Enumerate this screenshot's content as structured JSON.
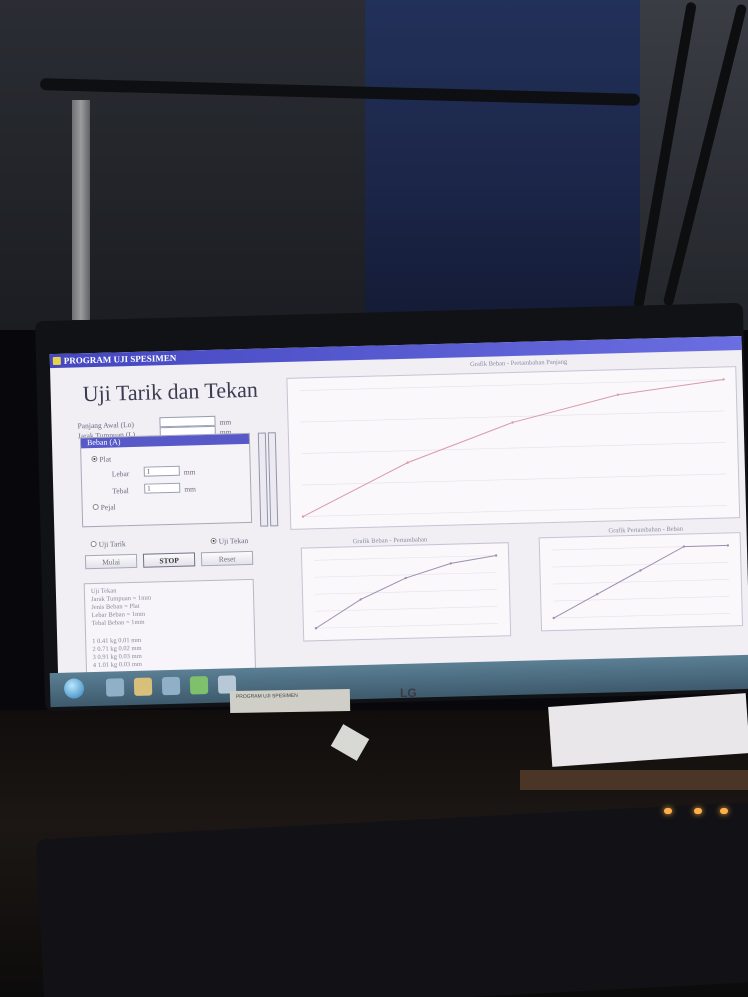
{
  "window": {
    "title": "PROGRAM UJI SPESIMEN"
  },
  "app": {
    "heading": "Uji Tarik dan Tekan"
  },
  "fields": {
    "panjang_awal": {
      "label": "Panjang Awal (Lo)",
      "value": "",
      "unit": "mm"
    },
    "jarak_tampuan": {
      "label": "Jarak Tumpuan (L)",
      "value": "",
      "unit": "mm"
    }
  },
  "beban_group": {
    "title": "Beban (A)",
    "option_plat": "Plat",
    "lebar_label": "Lebar",
    "lebar_value": "1",
    "lebar_unit": "mm",
    "tebal_label": "Tebal",
    "tebal_value": "1",
    "tebal_unit": "mm",
    "option_pejal": "Pejal"
  },
  "mode": {
    "uji_tarik": "Uji Tarik",
    "uji_tekan": "Uji Tekan"
  },
  "buttons": {
    "start": "Mulai",
    "stop": "STOP",
    "reset": "Reset"
  },
  "log": {
    "lines": [
      "Uji Tekan",
      "Jarak Tumpuan = 1mm",
      "Jenis Beban = Plat",
      "Lebar Beban = 1mm",
      "Tebal Beban = 1mm",
      "1 0.41 kg 0.01 mm",
      "2 0.71 kg 0.02 mm",
      "3 0.91 kg 0.03 mm",
      "4 1.01 kg 0.03 mm"
    ]
  },
  "charts": {
    "main_title": "Grafik Beban - Pertambahan Panjang",
    "bottom_left_title": "Grafik Beban - Pertambahan",
    "bottom_right_title": "Grafik Pertambahan - Beban"
  },
  "chart_data": [
    {
      "type": "line",
      "title": "Grafik Beban - Pertambahan Panjang",
      "x": [
        0,
        1,
        2,
        3,
        4
      ],
      "series": [
        {
          "values": [
            0,
            0.41,
            0.71,
            0.91,
            1.01
          ]
        }
      ]
    },
    {
      "type": "line",
      "title": "Grafik Beban - Pertambahan",
      "x": [
        0,
        1,
        2,
        3,
        4
      ],
      "series": [
        {
          "values": [
            0,
            0.41,
            0.71,
            0.91,
            1.01
          ]
        }
      ]
    },
    {
      "type": "line",
      "title": "Grafik Pertambahan - Beban",
      "x": [
        0,
        1,
        2,
        3,
        4
      ],
      "series": [
        {
          "values": [
            0,
            0.01,
            0.02,
            0.03,
            0.03
          ]
        }
      ]
    }
  ],
  "monitor": {
    "brand": "LG",
    "sticker": "PROGRAM UJI SPESIMEN"
  },
  "taskbar": {
    "tray_time": "",
    "tray_date": ""
  }
}
